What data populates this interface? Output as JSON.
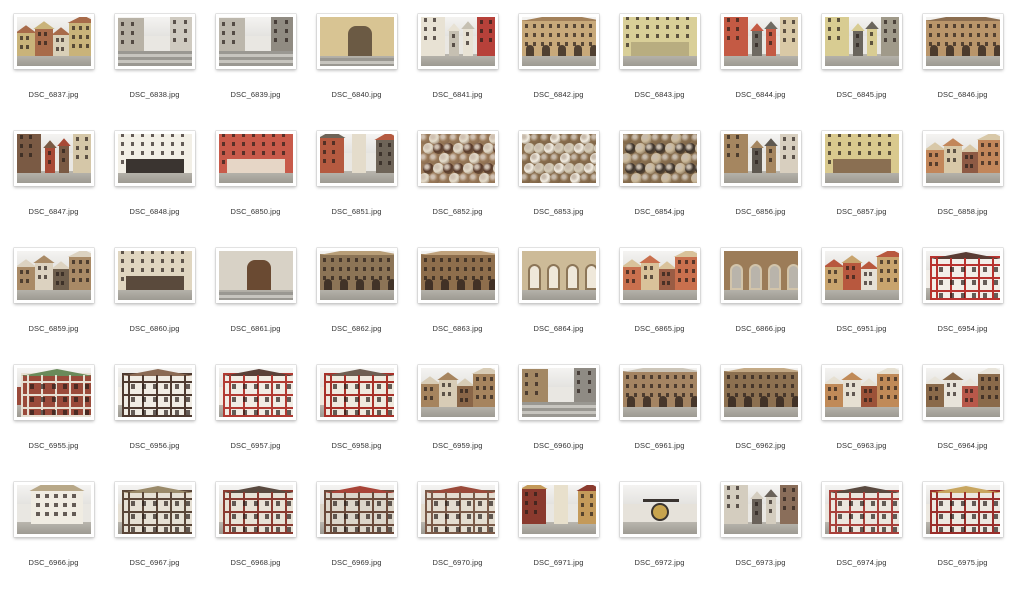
{
  "files": [
    {
      "name": "DSC_6837.jpg",
      "scene": "square",
      "colors": [
        "#c9b37a",
        "#a86b4a",
        "#d9d0b8"
      ]
    },
    {
      "name": "DSC_6838.jpg",
      "scene": "stairs",
      "colors": [
        "#b8b2a6",
        "#8f8a80",
        "#cfcac0"
      ]
    },
    {
      "name": "DSC_6839.jpg",
      "scene": "stairs",
      "colors": [
        "#bcb7ac",
        "#d8d3c8",
        "#908b82"
      ]
    },
    {
      "name": "DSC_6840.jpg",
      "scene": "door",
      "colors": [
        "#d8c493",
        "#6b5a44",
        "#e3d8b8"
      ]
    },
    {
      "name": "DSC_6841.jpg",
      "scene": "street",
      "colors": [
        "#e8e2d4",
        "#b7413a",
        "#c6c0b2"
      ]
    },
    {
      "name": "DSC_6842.jpg",
      "scene": "hall",
      "colors": [
        "#c8a97a",
        "#a3815a",
        "#e0d4b8"
      ]
    },
    {
      "name": "DSC_6843.jpg",
      "scene": "facade",
      "colors": [
        "#d9cf98",
        "#b8ad80",
        "#8a8472"
      ]
    },
    {
      "name": "DSC_6844.jpg",
      "scene": "street",
      "colors": [
        "#c45a44",
        "#d9c9a6",
        "#6f6a62"
      ]
    },
    {
      "name": "DSC_6845.jpg",
      "scene": "street",
      "colors": [
        "#d8cc92",
        "#a09a8a",
        "#6a655c"
      ]
    },
    {
      "name": "DSC_6846.jpg",
      "scene": "hall",
      "colors": [
        "#b9956a",
        "#8c6e50",
        "#d9ccb2"
      ]
    },
    {
      "name": "DSC_6847.jpg",
      "scene": "street",
      "colors": [
        "#7a5a44",
        "#d5c7a8",
        "#a84a36"
      ]
    },
    {
      "name": "DSC_6848.jpg",
      "scene": "facade",
      "colors": [
        "#f2efe6",
        "#3a3430",
        "#d8d2c4"
      ]
    },
    {
      "name": "DSC_6850.jpg",
      "scene": "shop",
      "colors": [
        "#c85a4a",
        "#e6d6c6",
        "#7a3a30"
      ]
    },
    {
      "name": "DSC_6851.jpg",
      "scene": "tower",
      "colors": [
        "#b55a40",
        "#e4dccb",
        "#6e6458"
      ]
    },
    {
      "name": "DSC_6852.jpg",
      "scene": "balls",
      "colors": [
        "#5a3c2c",
        "#e4dccb",
        "#9a7a5a"
      ]
    },
    {
      "name": "DSC_6853.jpg",
      "scene": "balls",
      "colors": [
        "#d6cdb8",
        "#f2ede2",
        "#8a6e4e"
      ]
    },
    {
      "name": "DSC_6854.jpg",
      "scene": "balls",
      "colors": [
        "#3e342c",
        "#cbb99a",
        "#8a7050"
      ]
    },
    {
      "name": "DSC_6856.jpg",
      "scene": "street",
      "colors": [
        "#a58660",
        "#d8cfbf",
        "#5e5850"
      ]
    },
    {
      "name": "DSC_6857.jpg",
      "scene": "facade",
      "colors": [
        "#d9c98e",
        "#8a6f52",
        "#e2dccd"
      ]
    },
    {
      "name": "DSC_6858.jpg",
      "scene": "square",
      "colors": [
        "#c2865a",
        "#d8c8a8",
        "#8e5a44"
      ]
    },
    {
      "name": "DSC_6859.jpg",
      "scene": "square",
      "colors": [
        "#a98a66",
        "#dcd2c0",
        "#6e5e4c"
      ]
    },
    {
      "name": "DSC_6860.jpg",
      "scene": "cafe",
      "colors": [
        "#e0d6c0",
        "#5a4a3c",
        "#a6442e"
      ]
    },
    {
      "name": "DSC_6861.jpg",
      "scene": "door",
      "colors": [
        "#d8d2c6",
        "#6a4a32",
        "#ebe6dc"
      ]
    },
    {
      "name": "DSC_6862.jpg",
      "scene": "hall",
      "colors": [
        "#8c7456",
        "#b89e78",
        "#dcd0b6"
      ]
    },
    {
      "name": "DSC_6863.jpg",
      "scene": "hall",
      "colors": [
        "#8e6e4c",
        "#c0a27c",
        "#e2ddd0"
      ]
    },
    {
      "name": "DSC_6864.jpg",
      "scene": "arcade",
      "colors": [
        "#cdbb98",
        "#8c7658",
        "#efe8da"
      ]
    },
    {
      "name": "DSC_6865.jpg",
      "scene": "square",
      "colors": [
        "#c9704e",
        "#d9c29a",
        "#9a5c44"
      ]
    },
    {
      "name": "DSC_6866.jpg",
      "scene": "arcade",
      "colors": [
        "#9c7c58",
        "#d2c4aa",
        "#b9b4ab"
      ]
    },
    {
      "name": "DSC_6951.jpg",
      "scene": "square",
      "colors": [
        "#c8a46e",
        "#b8583e",
        "#e6e1d6"
      ]
    },
    {
      "name": "DSC_6954.jpg",
      "scene": "timber",
      "colors": [
        "#b8322e",
        "#f2eee8",
        "#5a3c34"
      ]
    },
    {
      "name": "DSC_6955.jpg",
      "scene": "timber",
      "colors": [
        "#e6dfd2",
        "#9a4a3a",
        "#6a8a5a"
      ]
    },
    {
      "name": "DSC_6956.jpg",
      "scene": "timber",
      "colors": [
        "#4e3a30",
        "#f0ece4",
        "#8a6a54"
      ]
    },
    {
      "name": "DSC_6957.jpg",
      "scene": "timber",
      "colors": [
        "#b23a32",
        "#f1ece4",
        "#5a4038"
      ]
    },
    {
      "name": "DSC_6958.jpg",
      "scene": "timber",
      "colors": [
        "#a83028",
        "#efe9de",
        "#6e5e52"
      ]
    },
    {
      "name": "DSC_6959.jpg",
      "scene": "square",
      "colors": [
        "#a6845e",
        "#d8ccb6",
        "#8a6648"
      ]
    },
    {
      "name": "DSC_6960.jpg",
      "scene": "stairs",
      "colors": [
        "#a38864",
        "#d6d2ca",
        "#8f8b84"
      ]
    },
    {
      "name": "DSC_6961.jpg",
      "scene": "hall",
      "colors": [
        "#a48462",
        "#ccc5b8",
        "#7c6650"
      ]
    },
    {
      "name": "DSC_6962.jpg",
      "scene": "hall",
      "colors": [
        "#8c7050",
        "#c4aa86",
        "#e4dfd4"
      ]
    },
    {
      "name": "DSC_6963.jpg",
      "scene": "square",
      "colors": [
        "#c08a58",
        "#e6e0d2",
        "#9c5238"
      ]
    },
    {
      "name": "DSC_6964.jpg",
      "scene": "square",
      "colors": [
        "#8a6a4a",
        "#e8e4da",
        "#b8584a"
      ]
    },
    {
      "name": "DSC_6966.jpg",
      "scene": "gable",
      "colors": [
        "#f0ece2",
        "#7a8a7a",
        "#b8a888"
      ]
    },
    {
      "name": "DSC_6967.jpg",
      "scene": "timber",
      "colors": [
        "#5a4638",
        "#e6e0d4",
        "#9a8a6a"
      ]
    },
    {
      "name": "DSC_6968.jpg",
      "scene": "timber",
      "colors": [
        "#8a3a30",
        "#e8e2d6",
        "#5a4a40"
      ]
    },
    {
      "name": "DSC_6969.jpg",
      "scene": "timber",
      "colors": [
        "#6a4a3a",
        "#dcd6ca",
        "#a84438"
      ]
    },
    {
      "name": "DSC_6970.jpg",
      "scene": "timber",
      "colors": [
        "#7a5a48",
        "#e4ddd0",
        "#9a4a3a"
      ]
    },
    {
      "name": "DSC_6971.jpg",
      "scene": "tower",
      "colors": [
        "#8a3a2e",
        "#e8e0cc",
        "#c49a5a"
      ]
    },
    {
      "name": "DSC_6972.jpg",
      "scene": "sign",
      "colors": [
        "#e6e2da",
        "#3a3430",
        "#c8a44e"
      ]
    },
    {
      "name": "DSC_6973.jpg",
      "scene": "street",
      "colors": [
        "#d4cdbf",
        "#8a6e5a",
        "#6a625a"
      ]
    },
    {
      "name": "DSC_6974.jpg",
      "scene": "timber",
      "colors": [
        "#a8403a",
        "#ebe6de",
        "#5a4a40"
      ]
    },
    {
      "name": "DSC_6975.jpg",
      "scene": "timber",
      "colors": [
        "#9a2e2a",
        "#ece8e0",
        "#c8a660"
      ]
    }
  ]
}
